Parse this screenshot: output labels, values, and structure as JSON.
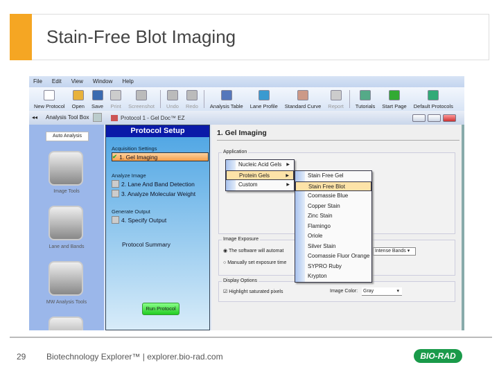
{
  "slide": {
    "title": "Stain-Free Blot Imaging",
    "page_number": "29",
    "footer": "Biotechnology Explorer™ |  explorer.bio-rad.com",
    "logo": "BIO-RAD"
  },
  "app": {
    "menu": [
      "File",
      "Edit",
      "View",
      "Window",
      "Help"
    ],
    "toolbar": [
      {
        "label": "New Protocol",
        "icon": "new-doc-icon"
      },
      {
        "label": "Open",
        "icon": "folder-icon"
      },
      {
        "label": "Save",
        "icon": "save-icon"
      },
      {
        "label": "Print",
        "icon": "print-icon",
        "disabled": true
      },
      {
        "label": "Screenshot",
        "icon": "camera-icon",
        "disabled": true
      },
      {
        "label": "Undo",
        "icon": "undo-icon",
        "disabled": true
      },
      {
        "label": "Redo",
        "icon": "redo-icon",
        "disabled": true
      },
      {
        "label": "Analysis Table",
        "icon": "table-icon"
      },
      {
        "label": "Lane Profile",
        "icon": "profile-icon"
      },
      {
        "label": "Standard Curve",
        "icon": "curve-icon"
      },
      {
        "label": "Report",
        "icon": "report-icon",
        "disabled": true
      },
      {
        "label": "Tutorials",
        "icon": "tutorial-icon"
      },
      {
        "label": "Start Page",
        "icon": "flag-icon"
      },
      {
        "label": "Default Protocols",
        "icon": "protocols-icon"
      }
    ],
    "toolbox_title": "Analysis Tool Box",
    "doc_tab": "Protocol 1 - Gel Doc™ EZ",
    "auto_analysis": "Auto Analysis",
    "tools": [
      "Image Tools",
      "Lane and Bands",
      "MW Analysis Tools"
    ],
    "setup": {
      "header": "Protocol Setup",
      "sections": [
        {
          "title": "Acquisition Settings",
          "steps": [
            {
              "label": "1. Gel Imaging",
              "checked": true,
              "active": true
            }
          ]
        },
        {
          "title": "Analyze Image",
          "steps": [
            {
              "label": "2. Lane And Band Detection"
            },
            {
              "label": "3. Analyze Molecular Weight"
            }
          ]
        },
        {
          "title": "Generate Output",
          "steps": [
            {
              "label": "4. Specify Output"
            }
          ]
        }
      ],
      "summary": "Protocol Summary",
      "run": "Run Protocol"
    },
    "content": {
      "heading": "1. Gel Imaging",
      "application_label": "Application",
      "menu": [
        "Nucleic Acid Gels",
        "Protein Gels",
        "Custom"
      ],
      "submenu": [
        "Stain Free Gel",
        "Stain Free Blot",
        "Coomassie Blue",
        "Copper Stain",
        "Zinc Stain",
        "Flamingo",
        "Oriole",
        "Silver Stain",
        "Coomassie Fluor Orange",
        "SYPRO Ruby",
        "Krypton"
      ],
      "exposure_label": "Image Exposure",
      "auto_option": "The software will automat",
      "manual_option": "Manually set exposure time",
      "intense_select": "Intense Bands",
      "display_label": "Display Options",
      "highlight": "Highlight saturated pixels",
      "color_label": "Image Color:",
      "color_value": "Gray"
    }
  }
}
